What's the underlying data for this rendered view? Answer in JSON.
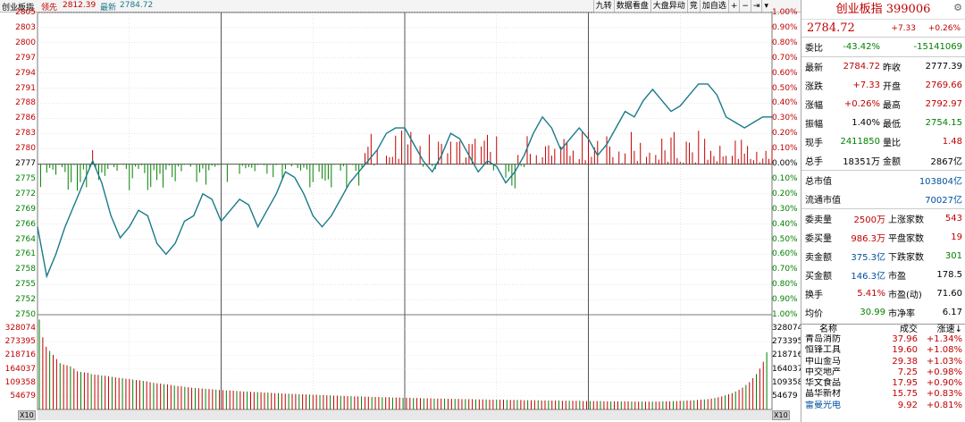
{
  "header": {
    "index_name": "创业板指",
    "prev_label": "领先",
    "prev_value": "2812.39",
    "latest_label": "最新",
    "latest_value": "2784.72",
    "buttons": [
      "九转",
      "数据看盘",
      "大盘异动",
      "竞",
      "加自选",
      "+",
      "−",
      "⇥",
      "▾"
    ]
  },
  "colors": {
    "up": "#c00000",
    "down": "#008000",
    "line": "#1a7a8a",
    "grid": "#888888"
  },
  "price_axis": {
    "labels": [
      "2805",
      "2803",
      "2800",
      "2797",
      "2794",
      "2791",
      "2788",
      "2786",
      "2783",
      "2780",
      "2777",
      "2775",
      "2772",
      "2769",
      "2766",
      "2764",
      "2761",
      "2758",
      "2755",
      "2752",
      "2750"
    ],
    "pct_labels": [
      "1.00%",
      "0.90%",
      "0.80%",
      "0.70%",
      "0.60%",
      "0.50%",
      "0.40%",
      "0.30%",
      "0.20%",
      "0.10%",
      "0.00%",
      "0.10%",
      "0.20%",
      "0.30%",
      "0.40%",
      "0.50%",
      "0.60%",
      "0.70%",
      "0.80%",
      "0.90%",
      "1.00%"
    ]
  },
  "volume_axis": {
    "labels": [
      "328074",
      "273395",
      "218716",
      "164037",
      "109358",
      "54679"
    ],
    "scale": "X10"
  },
  "chart_data": {
    "type": "line",
    "xlabel": "",
    "ylabel": "",
    "ylim": [
      2750,
      2805
    ],
    "baseline": 2777.39,
    "minutes": 240,
    "price_points": [
      [
        0,
        2766
      ],
      [
        3,
        2757
      ],
      [
        6,
        2761
      ],
      [
        9,
        2766
      ],
      [
        12,
        2770
      ],
      [
        15,
        2774
      ],
      [
        18,
        2778
      ],
      [
        21,
        2774
      ],
      [
        24,
        2768
      ],
      [
        27,
        2764
      ],
      [
        30,
        2766
      ],
      [
        33,
        2769
      ],
      [
        36,
        2768
      ],
      [
        39,
        2763
      ],
      [
        42,
        2761
      ],
      [
        45,
        2763
      ],
      [
        48,
        2767
      ],
      [
        51,
        2768
      ],
      [
        54,
        2772
      ],
      [
        57,
        2771
      ],
      [
        60,
        2767
      ],
      [
        63,
        2769
      ],
      [
        66,
        2771
      ],
      [
        69,
        2770
      ],
      [
        72,
        2766
      ],
      [
        75,
        2769
      ],
      [
        78,
        2772
      ],
      [
        81,
        2776
      ],
      [
        84,
        2775
      ],
      [
        87,
        2772
      ],
      [
        90,
        2768
      ],
      [
        93,
        2766
      ],
      [
        96,
        2768
      ],
      [
        99,
        2771
      ],
      [
        102,
        2774
      ],
      [
        105,
        2776
      ],
      [
        108,
        2778
      ],
      [
        111,
        2780
      ],
      [
        114,
        2783
      ],
      [
        117,
        2784
      ],
      [
        120,
        2784
      ],
      [
        123,
        2781
      ],
      [
        126,
        2778
      ],
      [
        129,
        2776
      ],
      [
        132,
        2779
      ],
      [
        135,
        2783
      ],
      [
        138,
        2782
      ],
      [
        141,
        2779
      ],
      [
        144,
        2776
      ],
      [
        147,
        2778
      ],
      [
        150,
        2777
      ],
      [
        153,
        2774
      ],
      [
        156,
        2776
      ],
      [
        159,
        2779
      ],
      [
        162,
        2783
      ],
      [
        165,
        2786
      ],
      [
        168,
        2784
      ],
      [
        171,
        2780
      ],
      [
        174,
        2782
      ],
      [
        177,
        2784
      ],
      [
        180,
        2782
      ],
      [
        183,
        2779
      ],
      [
        186,
        2781
      ],
      [
        189,
        2784
      ],
      [
        192,
        2787
      ],
      [
        195,
        2786
      ],
      [
        198,
        2789
      ],
      [
        201,
        2791
      ],
      [
        204,
        2789
      ],
      [
        207,
        2787
      ],
      [
        210,
        2788
      ],
      [
        213,
        2790
      ],
      [
        216,
        2792
      ],
      [
        219,
        2792
      ],
      [
        222,
        2790
      ],
      [
        225,
        2786
      ],
      [
        228,
        2785
      ],
      [
        231,
        2784
      ],
      [
        234,
        2785
      ],
      [
        237,
        2786
      ],
      [
        240,
        2786
      ]
    ],
    "volume_scale_max": 328074,
    "volume": [
      330000,
      265000,
      230000,
      215000,
      200000,
      185000,
      170000,
      165000,
      162000,
      158000,
      150000,
      140000,
      138000,
      136000,
      135000,
      130000,
      128000,
      127000,
      125000,
      124000,
      122000,
      120000,
      118000,
      116000,
      115000,
      113000,
      112000,
      110000,
      108000,
      107000,
      105000,
      103000,
      100000,
      98000,
      96000,
      95000,
      93000,
      92000,
      90000,
      88000,
      86000,
      85000,
      83000,
      82000,
      80000,
      79000,
      78000,
      77000,
      76000,
      75000,
      74000,
      73000,
      72000,
      71000,
      70000,
      70000,
      69000,
      68000,
      67000,
      66000,
      66000,
      65000,
      64000,
      64000,
      63000,
      62000,
      62000,
      61000,
      60000,
      60000,
      59000,
      58000,
      58000,
      57000,
      57000,
      56000,
      56000,
      55000,
      55000,
      54000,
      54000,
      53000,
      53000,
      52000,
      52000,
      51000,
      51000,
      50000,
      50000,
      49000,
      49000,
      48000,
      48000,
      48000,
      47000,
      47000,
      46000,
      46000,
      46000,
      45000,
      45000,
      45000,
      44000,
      44000,
      44000,
      43000,
      43000,
      43000,
      42000,
      42000,
      42000,
      41000,
      41000,
      41000,
      40000,
      40000,
      40000,
      40000,
      39000,
      39000,
      39000,
      39000,
      38000,
      38000,
      38000,
      38000,
      37000,
      37000,
      37000,
      37000,
      36000,
      36000,
      36000,
      36000,
      36000,
      35000,
      35000,
      35000,
      35000,
      35000,
      34000,
      34000,
      34000,
      34000,
      34000,
      33000,
      33000,
      33000,
      33000,
      33000,
      33000,
      32000,
      32000,
      32000,
      32000,
      32000,
      32000,
      31000,
      31000,
      31000,
      31000,
      31000,
      31000,
      30000,
      30000,
      30000,
      30000,
      30000,
      30000,
      30000,
      30000,
      29000,
      29000,
      29000,
      29000,
      29000,
      29000,
      29000,
      29000,
      29000,
      30000,
      30000,
      30000,
      31000,
      31000,
      32000,
      32000,
      33000,
      33000,
      34000,
      35000,
      36000,
      37000,
      38000,
      40000,
      42000,
      45000,
      48000,
      52000,
      56000,
      60000,
      66000,
      72000,
      80000,
      90000,
      100000,
      115000,
      130000,
      150000,
      175000,
      210000
    ]
  },
  "panel": {
    "title": "创业板指 399006",
    "price": "2784.72",
    "change": "+7.33",
    "change_pct": "+0.26%",
    "weibi_label": "委比",
    "weibi_pct": "-43.42%",
    "weibi_val": "-15141069",
    "rows": [
      {
        "k": "最新",
        "v": "2784.72",
        "k2": "昨收",
        "v2": "2777.39"
      },
      {
        "k": "涨跌",
        "v": "+7.33",
        "k2": "开盘",
        "v2": "2769.66"
      },
      {
        "k": "涨幅",
        "v": "+0.26%",
        "k2": "最高",
        "v2": "2792.97"
      },
      {
        "k": "振幅",
        "v": "1.40%",
        "k2": "最低",
        "v2": "2754.15"
      },
      {
        "k": "现手",
        "v": "2411850",
        "k2": "量比",
        "v2": "1.48"
      },
      {
        "k": "总手",
        "v": "18351万",
        "k2": "金额",
        "v2": "2867亿"
      }
    ],
    "cap_rows": [
      {
        "k": "总市值",
        "v": "103804亿"
      },
      {
        "k": "流通市值",
        "v": "70027亿"
      }
    ],
    "order_rows": [
      {
        "k": "委卖量",
        "v": "2500万",
        "k2": "上涨家数",
        "v2": "543"
      },
      {
        "k": "委买量",
        "v": "986.3万",
        "k2": "平盘家数",
        "v2": "19"
      },
      {
        "k": "卖金额",
        "v": "375.3亿",
        "k2": "下跌家数",
        "v2": "301"
      },
      {
        "k": "买金额",
        "v": "146.3亿",
        "k2": "市盈",
        "v2": "178.5"
      },
      {
        "k": "换手",
        "v": "5.41%",
        "k2": "市盈(动)",
        "v2": "71.60"
      },
      {
        "k": "均价",
        "v": "30.99",
        "k2": "市净率",
        "v2": "6.17"
      }
    ],
    "stock_headers": [
      "名称",
      "成交",
      "涨速"
    ],
    "stocks": [
      {
        "n": "青岛消防",
        "p": "37.96",
        "r": "+1.34%"
      },
      {
        "n": "恒锋工具",
        "p": "19.60",
        "r": "+1.08%"
      },
      {
        "n": "中山金马",
        "p": "29.38",
        "r": "+1.03%"
      },
      {
        "n": "中交地产",
        "p": "7.25",
        "r": "+0.98%"
      },
      {
        "n": "华文食品",
        "p": "17.95",
        "r": "+0.90%"
      },
      {
        "n": "晶华新材",
        "p": "15.75",
        "r": "+0.83%"
      },
      {
        "n": "雷曼光电",
        "p": "9.92",
        "r": "+0.81%"
      }
    ]
  }
}
